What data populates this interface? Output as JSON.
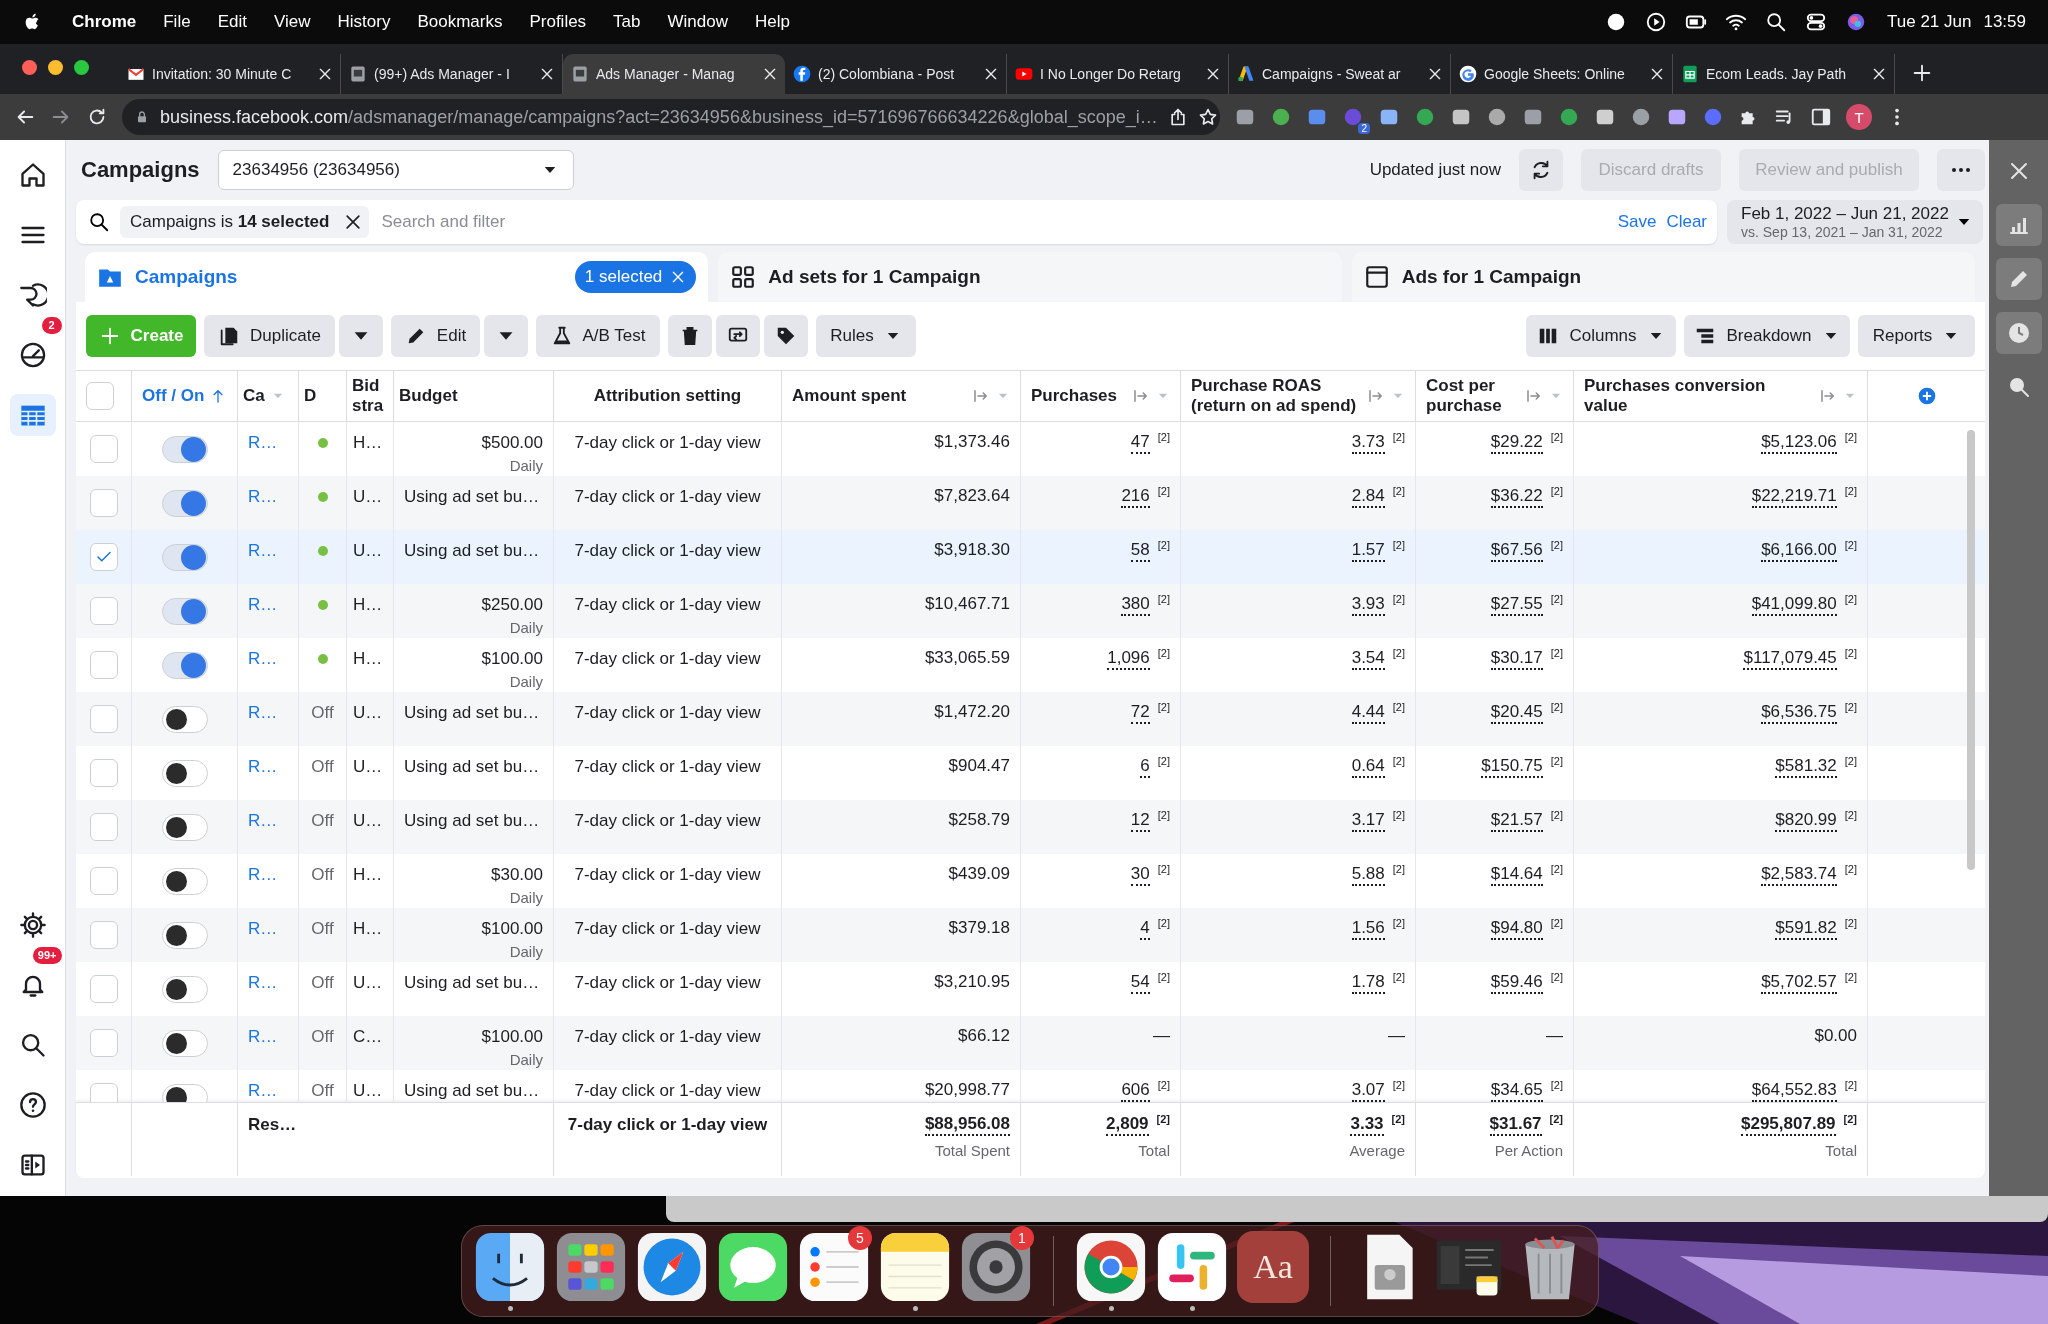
{
  "menu_bar": {
    "app": "Chrome",
    "items": [
      "File",
      "Edit",
      "View",
      "History",
      "Bookmarks",
      "Profiles",
      "Tab",
      "Window",
      "Help"
    ],
    "date": "Tue 21 Jun",
    "time": "13:59"
  },
  "browser": {
    "tabs": [
      {
        "title": "Invitation: 30 Minute C",
        "kind": "mail",
        "selected": false
      },
      {
        "title": "(99+) Ads Manager - I",
        "kind": "page",
        "selected": false
      },
      {
        "title": "Ads Manager - Manag",
        "kind": "page",
        "selected": true
      },
      {
        "title": "(2) Colombiana - Post",
        "kind": "social",
        "selected": false
      },
      {
        "title": "I No Longer Do Retarg",
        "kind": "video",
        "selected": false
      },
      {
        "title": "Campaigns - Sweat ar",
        "kind": "ads",
        "selected": false
      },
      {
        "title": "Google Sheets: Online",
        "kind": "search",
        "selected": false
      },
      {
        "title": "Ecom Leads. Jay Path",
        "kind": "sheet",
        "selected": false
      }
    ],
    "url_host": "business.facebook.com",
    "url_path": "/adsmanager/manage/campaigns?act=23634956&business_id=571696766634226&global_scope_i…",
    "extension_badge": "2",
    "profile_initial": "T"
  },
  "left_nav": {
    "top": [
      {
        "kind": "home",
        "selected": false
      },
      {
        "kind": "menu",
        "selected": false
      },
      {
        "kind": "logo",
        "selected": false
      },
      {
        "kind": "gauge",
        "selected": false,
        "badge": "2"
      },
      {
        "kind": "table",
        "selected": true
      }
    ],
    "bottom": [
      {
        "kind": "gear",
        "selected": false
      },
      {
        "kind": "bell",
        "selected": false,
        "badge": "99+"
      },
      {
        "kind": "search",
        "selected": false
      },
      {
        "kind": "help",
        "selected": false
      },
      {
        "kind": "panel",
        "selected": false
      }
    ]
  },
  "header": {
    "title": "Campaigns",
    "account": "23634956 (23634956)",
    "updated": "Updated just now",
    "discard": "Discard drafts",
    "publish": "Review and publish",
    "discard_disabled": true,
    "publish_disabled": true
  },
  "filter": {
    "chip": "Campaigns is **14 selected**",
    "placeholder": "Search and filter",
    "save": "Save",
    "clear": "Clear"
  },
  "date_range": {
    "range": "Feb 1, 2022 – Jun 21, 2022",
    "compare": "vs. Sep 13, 2021 – Jan 31, 2022"
  },
  "level_tabs": [
    {
      "label": "Campaigns",
      "kind": "folder",
      "selected": true,
      "chip": "1 selected"
    },
    {
      "label": "Ad sets for 1 Campaign",
      "kind": "grid",
      "selected": false
    },
    {
      "label": "Ads for 1 Campaign",
      "kind": "window",
      "selected": false
    }
  ],
  "toolbar": {
    "create": "Create",
    "duplicate": "Duplicate",
    "edit": "Edit",
    "ab_test": "A/B Test",
    "rules": "Rules",
    "columns": "Columns",
    "breakdown": "Breakdown",
    "reports": "Reports"
  },
  "table": {
    "columns": [
      {
        "kind": "check",
        "sorted": false
      },
      {
        "kind": "toggle",
        "label": "Off / On",
        "sorted": true
      },
      {
        "kind": "name",
        "label": "Ca",
        "sorted": false
      },
      {
        "kind": "plain",
        "label": "D",
        "sorted": false
      },
      {
        "kind": "plain",
        "label": "Bid stra",
        "sorted": false
      },
      {
        "kind": "plain",
        "label": "Budget",
        "sorted": false
      },
      {
        "kind": "center",
        "label": "Attribution setting",
        "sorted": false
      },
      {
        "kind": "metric",
        "label": "Amount spent",
        "sorted": false
      },
      {
        "kind": "metric",
        "label": "Purchases",
        "sorted": false
      },
      {
        "kind": "metric",
        "label": "Purchase ROAS (return on ad spend)",
        "sorted": false
      },
      {
        "kind": "metric",
        "label": "Cost per purchase",
        "sorted": false
      },
      {
        "kind": "metric",
        "label": "Purchases conversion value",
        "sorted": false
      },
      {
        "kind": "add",
        "sorted": false
      }
    ],
    "select_all_checked": false,
    "rows": [
      {
        "checked": false,
        "on": true,
        "name": "R…",
        "delivery": {
          "kind": "dot"
        },
        "bid": "H…",
        "budget": {
          "amount": "$500.00",
          "period": "Daily"
        },
        "attribution": "7-day click or 1-day view",
        "metrics": [
          {
            "value": "$1,373.46"
          },
          {
            "value": "47",
            "note": "[2]"
          },
          {
            "value": "3.73",
            "note": "[2]"
          },
          {
            "value": "$29.22",
            "note": "[2]"
          },
          {
            "value": "$5,123.06",
            "note": "[2]"
          }
        ]
      },
      {
        "checked": false,
        "on": true,
        "name": "R…",
        "delivery": {
          "kind": "dot"
        },
        "bid": "U…",
        "budget": {
          "amount": "Using ad set bu…"
        },
        "attribution": "7-day click or 1-day view",
        "metrics": [
          {
            "value": "$7,823.64"
          },
          {
            "value": "216",
            "note": "[2]"
          },
          {
            "value": "2.84",
            "note": "[2]"
          },
          {
            "value": "$36.22",
            "note": "[2]"
          },
          {
            "value": "$22,219.71",
            "note": "[2]"
          }
        ]
      },
      {
        "checked": true,
        "on": true,
        "name": "R…",
        "delivery": {
          "kind": "dot"
        },
        "bid": "U…",
        "budget": {
          "amount": "Using ad set bu…"
        },
        "attribution": "7-day click or 1-day view",
        "metrics": [
          {
            "value": "$3,918.30"
          },
          {
            "value": "58",
            "note": "[2]"
          },
          {
            "value": "1.57",
            "note": "[2]"
          },
          {
            "value": "$67.56",
            "note": "[2]"
          },
          {
            "value": "$6,166.00",
            "note": "[2]"
          }
        ]
      },
      {
        "checked": false,
        "on": true,
        "name": "R…",
        "delivery": {
          "kind": "dot"
        },
        "bid": "H…",
        "budget": {
          "amount": "$250.00",
          "period": "Daily"
        },
        "attribution": "7-day click or 1-day view",
        "metrics": [
          {
            "value": "$10,467.71"
          },
          {
            "value": "380",
            "note": "[2]"
          },
          {
            "value": "3.93",
            "note": "[2]"
          },
          {
            "value": "$27.55",
            "note": "[2]"
          },
          {
            "value": "$41,099.80",
            "note": "[2]"
          }
        ]
      },
      {
        "checked": false,
        "on": true,
        "name": "R…",
        "delivery": {
          "kind": "dot"
        },
        "bid": "H…",
        "budget": {
          "amount": "$100.00",
          "period": "Daily"
        },
        "attribution": "7-day click or 1-day view",
        "metrics": [
          {
            "value": "$33,065.59"
          },
          {
            "value": "1,096",
            "note": "[2]"
          },
          {
            "value": "3.54",
            "note": "[2]"
          },
          {
            "value": "$30.17",
            "note": "[2]"
          },
          {
            "value": "$117,079.45",
            "note": "[2]"
          }
        ]
      },
      {
        "checked": false,
        "on": false,
        "name": "R…",
        "delivery": {
          "kind": "text",
          "text": "Off"
        },
        "bid": "U…",
        "budget": {
          "amount": "Using ad set bu…"
        },
        "attribution": "7-day click or 1-day view",
        "metrics": [
          {
            "value": "$1,472.20"
          },
          {
            "value": "72",
            "note": "[2]"
          },
          {
            "value": "4.44",
            "note": "[2]"
          },
          {
            "value": "$20.45",
            "note": "[2]"
          },
          {
            "value": "$6,536.75",
            "note": "[2]"
          }
        ]
      },
      {
        "checked": false,
        "on": false,
        "name": "R…",
        "delivery": {
          "kind": "text",
          "text": "Off"
        },
        "bid": "U…",
        "budget": {
          "amount": "Using ad set bu…"
        },
        "attribution": "7-day click or 1-day view",
        "metrics": [
          {
            "value": "$904.47"
          },
          {
            "value": "6",
            "note": "[2]"
          },
          {
            "value": "0.64",
            "note": "[2]"
          },
          {
            "value": "$150.75",
            "note": "[2]"
          },
          {
            "value": "$581.32",
            "note": "[2]"
          }
        ]
      },
      {
        "checked": false,
        "on": false,
        "name": "R…",
        "delivery": {
          "kind": "text",
          "text": "Off"
        },
        "bid": "U…",
        "budget": {
          "amount": "Using ad set bu…"
        },
        "attribution": "7-day click or 1-day view",
        "metrics": [
          {
            "value": "$258.79"
          },
          {
            "value": "12",
            "note": "[2]"
          },
          {
            "value": "3.17",
            "note": "[2]"
          },
          {
            "value": "$21.57",
            "note": "[2]"
          },
          {
            "value": "$820.99",
            "note": "[2]"
          }
        ]
      },
      {
        "checked": false,
        "on": false,
        "name": "R…",
        "delivery": {
          "kind": "text",
          "text": "Off"
        },
        "bid": "H…",
        "budget": {
          "amount": "$30.00",
          "period": "Daily"
        },
        "attribution": "7-day click or 1-day view",
        "metrics": [
          {
            "value": "$439.09"
          },
          {
            "value": "30",
            "note": "[2]"
          },
          {
            "value": "5.88",
            "note": "[2]"
          },
          {
            "value": "$14.64",
            "note": "[2]"
          },
          {
            "value": "$2,583.74",
            "note": "[2]"
          }
        ]
      },
      {
        "checked": false,
        "on": false,
        "name": "R…",
        "delivery": {
          "kind": "text",
          "text": "Off"
        },
        "bid": "H…",
        "budget": {
          "amount": "$100.00",
          "period": "Daily"
        },
        "attribution": "7-day click or 1-day view",
        "metrics": [
          {
            "value": "$379.18"
          },
          {
            "value": "4",
            "note": "[2]"
          },
          {
            "value": "1.56",
            "note": "[2]"
          },
          {
            "value": "$94.80",
            "note": "[2]"
          },
          {
            "value": "$591.82",
            "note": "[2]"
          }
        ]
      },
      {
        "checked": false,
        "on": false,
        "name": "R…",
        "delivery": {
          "kind": "text",
          "text": "Off"
        },
        "bid": "U…",
        "budget": {
          "amount": "Using ad set bu…"
        },
        "attribution": "7-day click or 1-day view",
        "metrics": [
          {
            "value": "$3,210.95"
          },
          {
            "value": "54",
            "note": "[2]"
          },
          {
            "value": "1.78",
            "note": "[2]"
          },
          {
            "value": "$59.46",
            "note": "[2]"
          },
          {
            "value": "$5,702.57",
            "note": "[2]"
          }
        ]
      },
      {
        "checked": false,
        "on": false,
        "name": "R…",
        "delivery": {
          "kind": "text",
          "text": "Off"
        },
        "bid": "C…",
        "budget": {
          "amount": "$100.00",
          "period": "Daily"
        },
        "attribution": "7-day click or 1-day view",
        "metrics": [
          {
            "value": "$66.12"
          },
          {
            "value": "—"
          },
          {
            "value": "—"
          },
          {
            "value": "—"
          },
          {
            "value": "$0.00"
          }
        ]
      },
      {
        "checked": false,
        "on": false,
        "name": "R…",
        "delivery": {
          "kind": "text",
          "text": "Off"
        },
        "bid": "U…",
        "budget": {
          "amount": "Using ad set bu…"
        },
        "attribution": "7-day click or 1-day view",
        "metrics": [
          {
            "value": "$20,998.77"
          },
          {
            "value": "606",
            "note": "[2]"
          },
          {
            "value": "3.07",
            "note": "[2]"
          },
          {
            "value": "$34.65",
            "note": "[2]"
          },
          {
            "value": "$64,552.83",
            "note": "[2]"
          }
        ]
      }
    ],
    "footer": {
      "name": "Res…",
      "attribution": "7-day click or 1-day view",
      "metrics": [
        {
          "value": "$88,956.08",
          "label": "Total Spent"
        },
        {
          "value": "2,809",
          "note": "[2]",
          "label": "Total"
        },
        {
          "value": "3.33",
          "note": "[2]",
          "label": "Average"
        },
        {
          "value": "$31.67",
          "note": "[2]",
          "label": "Per Action"
        },
        {
          "value": "$295,807.89",
          "note": "[2]",
          "label": "Total"
        }
      ]
    }
  },
  "right_panel": [
    {
      "kind": "close",
      "selected": false
    },
    {
      "kind": "chart",
      "selected": true
    },
    {
      "kind": "pencil",
      "selected": true
    },
    {
      "kind": "clock",
      "selected": true
    },
    {
      "kind": "zoom",
      "selected": false
    }
  ],
  "dock": [
    {
      "kind": "finder",
      "running": true
    },
    {
      "kind": "launchpad",
      "running": false
    },
    {
      "kind": "safari",
      "running": false
    },
    {
      "kind": "messages",
      "running": false
    },
    {
      "kind": "reminders",
      "running": false,
      "badge": "5"
    },
    {
      "kind": "notes",
      "running": true
    },
    {
      "kind": "settings",
      "running": false,
      "badge": "1"
    },
    {
      "kind": "separator"
    },
    {
      "kind": "chrome",
      "running": true
    },
    {
      "kind": "slack",
      "running": true
    },
    {
      "kind": "dictionary",
      "running": false,
      "label": "Aa"
    },
    {
      "kind": "separator"
    },
    {
      "kind": "disk",
      "running": false
    },
    {
      "kind": "thumbnail",
      "running": false
    },
    {
      "kind": "trash",
      "running": false
    }
  ]
}
